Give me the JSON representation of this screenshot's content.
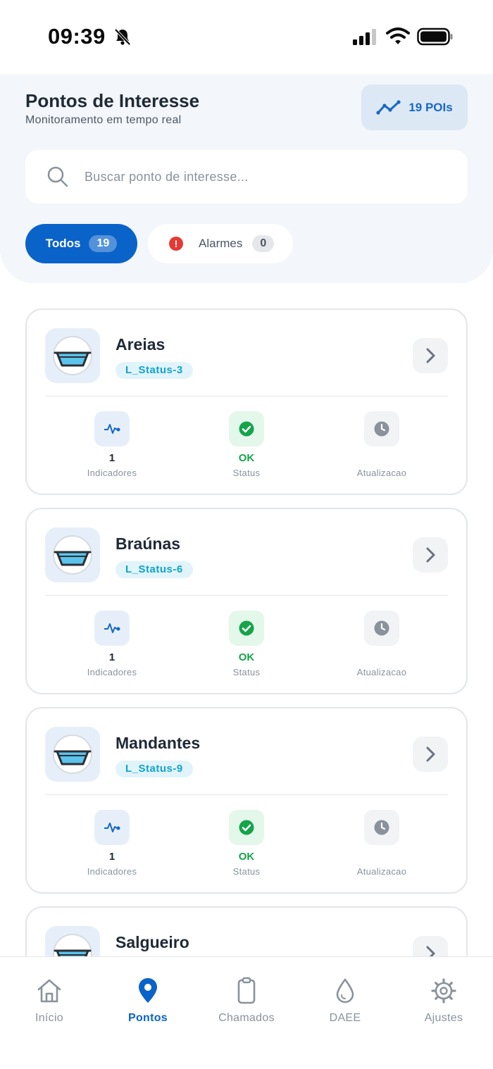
{
  "status_bar": {
    "time": "09:39"
  },
  "header": {
    "title": "Pontos de Interesse",
    "subtitle": "Monitoramento em tempo real",
    "poi_badge": "19 POIs"
  },
  "search": {
    "placeholder": "Buscar ponto de interesse..."
  },
  "filters": {
    "all": {
      "label": "Todos",
      "count": "19"
    },
    "alarms": {
      "label": "Alarmes",
      "count": "0"
    }
  },
  "colors": {
    "accent": "#0a63c9",
    "status_ok": "#16a34a",
    "alarm": "#e53935",
    "tag_text": "#12a3c7"
  },
  "stat_labels": {
    "indicators": "Indicadores",
    "status": "Status",
    "updated": "Atualizacao"
  },
  "points": [
    {
      "name": "Areias",
      "tag": "L_Status-3",
      "indicators": "1",
      "status": "OK",
      "updated": ""
    },
    {
      "name": "Braúnas",
      "tag": "L_Status-6",
      "indicators": "1",
      "status": "OK",
      "updated": ""
    },
    {
      "name": "Mandantes",
      "tag": "L_Status-9",
      "indicators": "1",
      "status": "OK",
      "updated": ""
    },
    {
      "name": "Salgueiro"
    }
  ],
  "tabs": [
    {
      "label": "Início",
      "icon": "home-icon"
    },
    {
      "label": "Pontos",
      "icon": "map-pin-icon",
      "active": true
    },
    {
      "label": "Chamados",
      "icon": "clipboard-icon"
    },
    {
      "label": "DAEE",
      "icon": "water-drop-icon"
    },
    {
      "label": "Ajustes",
      "icon": "gear-icon"
    }
  ]
}
